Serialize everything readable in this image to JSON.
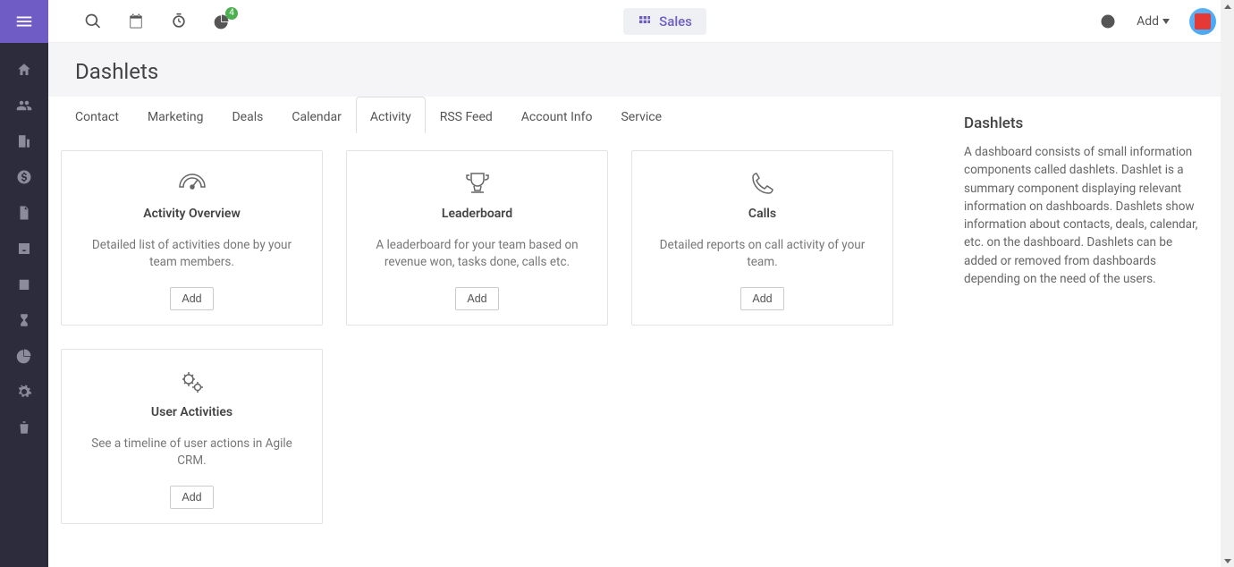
{
  "topbar": {
    "badge": "4",
    "center_label": "Sales",
    "add_label": "Add"
  },
  "page": {
    "title": "Dashlets"
  },
  "tabs": [
    "Contact",
    "Marketing",
    "Deals",
    "Calendar",
    "Activity",
    "RSS Feed",
    "Account Info",
    "Service"
  ],
  "active_tab_index": 4,
  "cards": [
    {
      "title": "Activity Overview",
      "desc": "Detailed list of activities done by your team members.",
      "btn": "Add",
      "icon": "gauge"
    },
    {
      "title": "Leaderboard",
      "desc": "A leaderboard for your team based on revenue won, tasks done, calls etc.",
      "btn": "Add",
      "icon": "trophy"
    },
    {
      "title": "Calls",
      "desc": "Detailed reports on call activity of your team.",
      "btn": "Add",
      "icon": "phone"
    },
    {
      "title": "User Activities",
      "desc": "See a timeline of user actions in Agile CRM.",
      "btn": "Add",
      "icon": "gears"
    }
  ],
  "info": {
    "title": "Dashlets",
    "text": "A dashboard consists of small information components called dashlets. Dashlet is a summary component displaying relevant information on dashboards. Dashlets show information about contacts, deals, calendar, etc. on the dashboard. Dashlets can be added or removed from dashboards depending on the need of the users."
  }
}
